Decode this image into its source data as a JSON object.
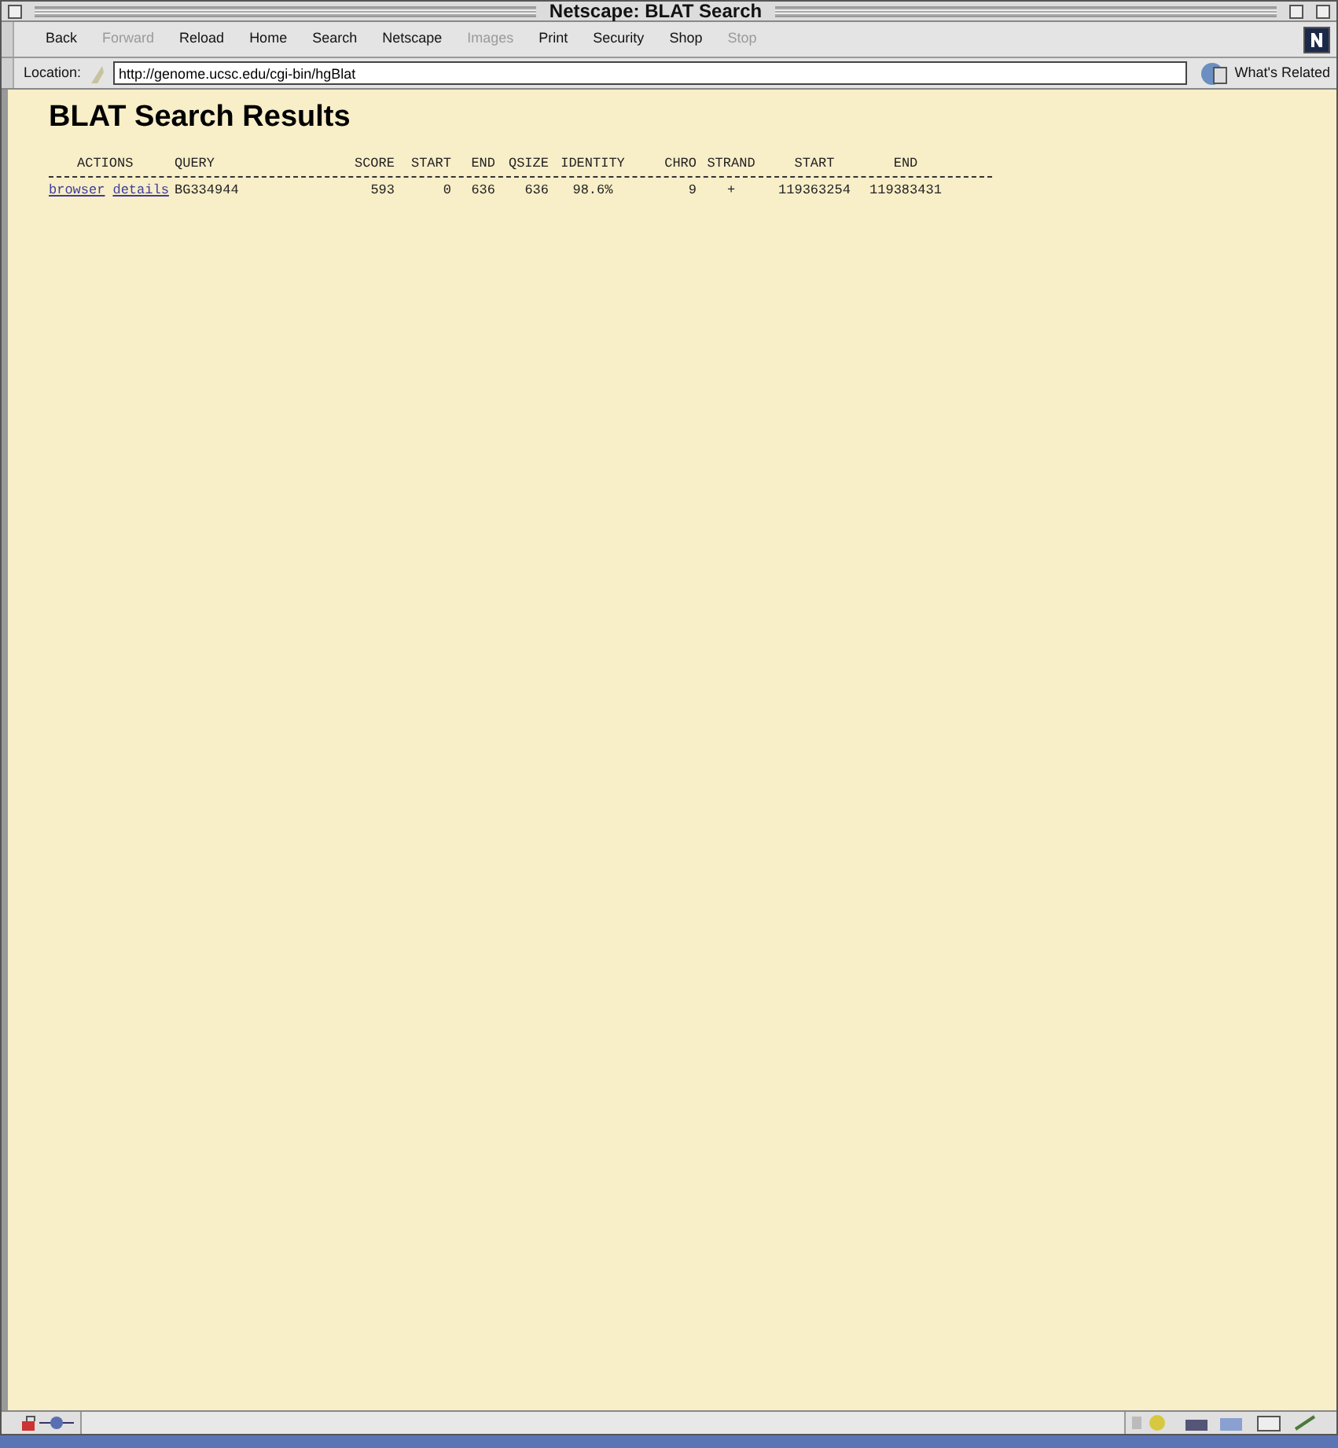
{
  "window": {
    "title": "Netscape: BLAT Search"
  },
  "toolbar": [
    {
      "label": "Back",
      "disabled": false
    },
    {
      "label": "Forward",
      "disabled": true
    },
    {
      "label": "Reload",
      "disabled": false
    },
    {
      "label": "Home",
      "disabled": false
    },
    {
      "label": "Search",
      "disabled": false
    },
    {
      "label": "Netscape",
      "disabled": false
    },
    {
      "label": "Images",
      "disabled": true
    },
    {
      "label": "Print",
      "disabled": false
    },
    {
      "label": "Security",
      "disabled": false
    },
    {
      "label": "Shop",
      "disabled": false
    },
    {
      "label": "Stop",
      "disabled": true
    }
  ],
  "location": {
    "label": "Location:",
    "value": "http://genome.ucsc.edu/cgi-bin/hgBlat",
    "related": "What's Related"
  },
  "page": {
    "heading": "BLAT Search Results",
    "table": {
      "columns": [
        "ACTIONS",
        "QUERY",
        "SCORE",
        "START",
        "END",
        "QSIZE",
        "IDENTITY",
        "CHRO",
        "STRAND",
        "START",
        "END"
      ],
      "rows": [
        {
          "cells": [
            {
              "kind": "links",
              "links": [
                "browser",
                "details"
              ]
            },
            {
              "kind": "text",
              "text": "BG334944"
            },
            {
              "kind": "text",
              "text": "593"
            },
            {
              "kind": "text",
              "text": "0"
            },
            {
              "kind": "text",
              "text": "636"
            },
            {
              "kind": "text",
              "text": "636"
            },
            {
              "kind": "text",
              "text": "98.6%"
            },
            {
              "kind": "text",
              "text": "9"
            },
            {
              "kind": "text",
              "text": "+"
            },
            {
              "kind": "text",
              "text": "119363254"
            },
            {
              "kind": "text",
              "text": "119383431"
            }
          ]
        }
      ]
    }
  }
}
